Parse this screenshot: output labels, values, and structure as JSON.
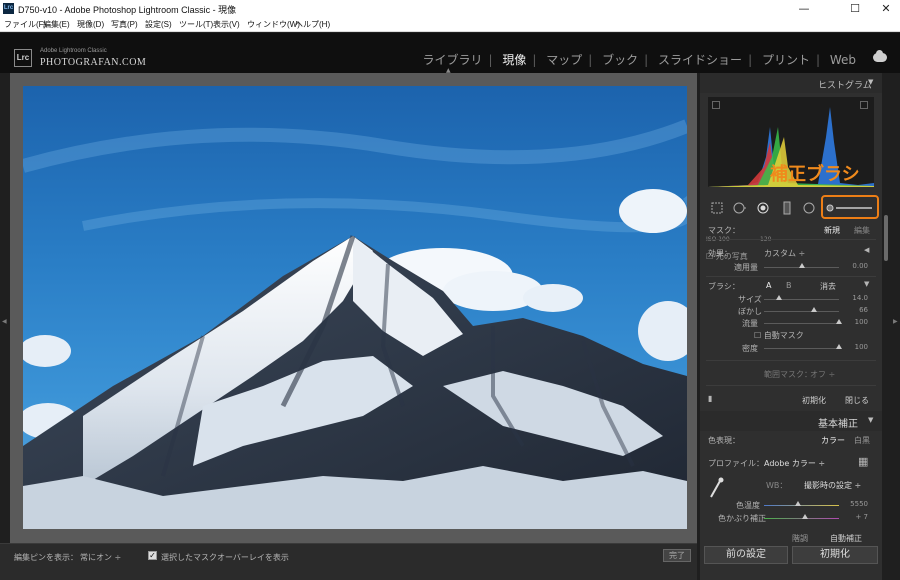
{
  "window": {
    "title": "D750-v10 - Adobe Photoshop Lightroom Classic - 現像",
    "app_icon": "Lrc",
    "buttons": [
      "—",
      "☐",
      "✕"
    ]
  },
  "menu": [
    "ファイル(F)",
    "編集(E)",
    "現像(D)",
    "写真(P)",
    "設定(S)",
    "ツール(T)",
    "表示(V)",
    "ウィンドウ(W)",
    "ヘルプ(H)"
  ],
  "identity": {
    "badge": "Lrc",
    "small": "Adobe Lightroom Classic",
    "big": "PHOTOGRAFAN.COM"
  },
  "modules": [
    "ライブラリ",
    "現像",
    "マップ",
    "ブック",
    "スライドショー",
    "プリント",
    "Web"
  ],
  "active_module": "現像",
  "toolbar": {
    "pin_label": "編集ピンを表示：",
    "pin_value": "常にオン ÷",
    "overlay_label": "選択したマスクオーバーレイを表示",
    "overlay_checked": "✓",
    "done": "完了"
  },
  "histogram": {
    "header": "ヒストグラム",
    "collapse": "▼",
    "iso": "ISO 100",
    "focal": "120",
    "original_photo": "元の写真"
  },
  "annotation": "補正ブラシ",
  "mask": {
    "label": "マスク：",
    "new": "新規",
    "edit": "編集"
  },
  "effect": {
    "label": "効果：",
    "value": "カスタム ÷",
    "amount_label": "適用量",
    "amount_value": "0.00",
    "amount_level": 0.5
  },
  "brush": {
    "label": "ブラシ：",
    "a": "A",
    "b": "B",
    "erase": "消去",
    "rows": [
      {
        "label": "サイズ",
        "value": "14.0",
        "level": 0.2
      },
      {
        "label": "ぼかし",
        "value": "66",
        "level": 0.66
      },
      {
        "label": "流量",
        "value": "100",
        "level": 1.0
      }
    ],
    "auto_mask": "自動マスク",
    "density_label": "密度",
    "density_value": "100",
    "density_level": 1.0
  },
  "range_mask": {
    "label": "範囲マスク：",
    "value": "オフ ÷"
  },
  "panel_buttons": {
    "reset": "初期化",
    "close": "閉じる"
  },
  "basic": {
    "header": "基本補正",
    "collapse": "▼",
    "treatment_label": "色表現：",
    "color": "カラー",
    "bw": "白黒",
    "profile_label": "プロファイル：",
    "profile_value": "Adobe カラー ÷",
    "wb_label": "WB：",
    "wb_value": "撮影時の設定 ÷",
    "temp_label": "色温度",
    "temp_value": "5550",
    "temp_level": 0.45,
    "tint_label": "色かぶり補正",
    "tint_value": "+ 7",
    "tint_level": 0.55,
    "tone_label": "階調",
    "auto": "自動補正"
  },
  "bottom_buttons": {
    "previous": "前の設定",
    "reset": "初期化"
  },
  "colors": {
    "accent_orange": "#ec7e16",
    "sky_blue": "#2a7ec6",
    "panel_bg": "#2f2f2f"
  }
}
